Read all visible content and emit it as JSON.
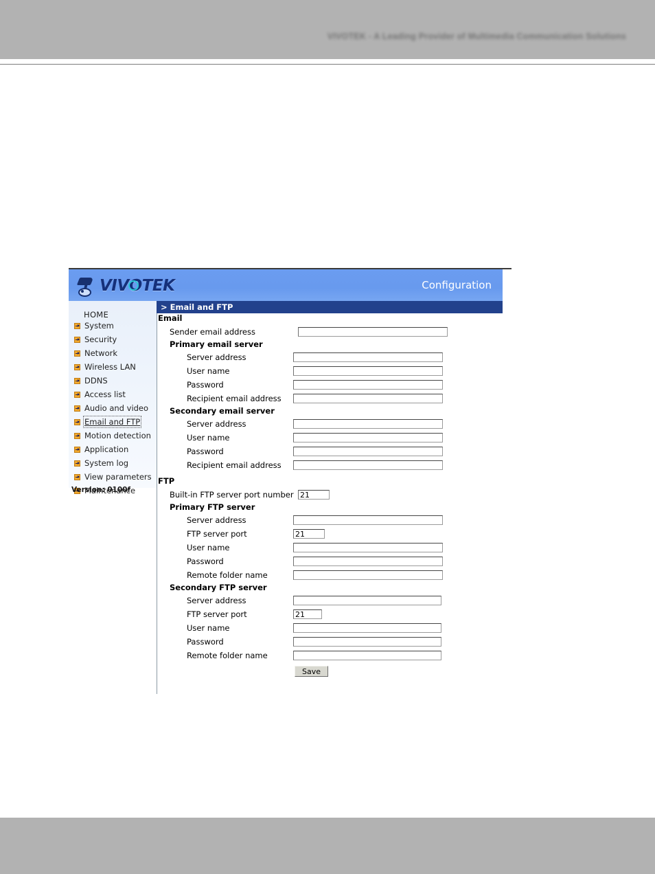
{
  "document": {
    "banner_tagline": "VIVOTEK - A Leading Provider of Multimedia Communication Solutions"
  },
  "header": {
    "logo_text_1": "VIV",
    "logo_text_o": "O",
    "logo_text_2": "TEK",
    "title": "Configuration",
    "bg_color": "#6699ee"
  },
  "titlebar": {
    "text": "> Email and FTP",
    "bg_color": "#22418c"
  },
  "sidebar": {
    "home_label": "HOME",
    "version": "Version: 0100f",
    "items": [
      {
        "label": "System",
        "active": false
      },
      {
        "label": "Security",
        "active": false
      },
      {
        "label": "Network",
        "active": false
      },
      {
        "label": "Wireless LAN",
        "active": false
      },
      {
        "label": "DDNS",
        "active": false
      },
      {
        "label": "Access list",
        "active": false
      },
      {
        "label": "Audio and video",
        "active": false
      },
      {
        "label": "Email and FTP",
        "active": true
      },
      {
        "label": "Motion detection",
        "active": false
      },
      {
        "label": "Application",
        "active": false
      },
      {
        "label": "System log",
        "active": false
      },
      {
        "label": "View parameters",
        "active": false
      },
      {
        "label": "Maintenance",
        "active": false
      }
    ]
  },
  "content": {
    "email_section": {
      "heading": "Email",
      "sender_label": "Sender email address",
      "sender_value": "",
      "primary": {
        "heading": "Primary email server",
        "server_address_label": "Server address",
        "server_address_value": "",
        "user_name_label": "User name",
        "user_name_value": "",
        "password_label": "Password",
        "password_value": "",
        "recipient_label": "Recipient email address",
        "recipient_value": ""
      },
      "secondary": {
        "heading": "Secondary email server",
        "server_address_label": "Server address",
        "server_address_value": "",
        "user_name_label": "User name",
        "user_name_value": "",
        "password_label": "Password",
        "password_value": "",
        "recipient_label": "Recipient email address",
        "recipient_value": ""
      }
    },
    "ftp_section": {
      "heading": "FTP",
      "builtin_port_label": "Built-in FTP server port number",
      "builtin_port_value": "21",
      "primary": {
        "heading": "Primary FTP server",
        "server_address_label": "Server address",
        "server_address_value": "",
        "port_label": "FTP server port",
        "port_value": "21",
        "user_name_label": "User name",
        "user_name_value": "",
        "password_label": "Password",
        "password_value": "",
        "remote_folder_label": "Remote folder name",
        "remote_folder_value": ""
      },
      "secondary": {
        "heading": "Secondary FTP server",
        "server_address_label": "Server address",
        "server_address_value": "",
        "port_label": "FTP server port",
        "port_value": "21",
        "user_name_label": "User name",
        "user_name_value": "",
        "password_label": "Password",
        "password_value": "",
        "remote_folder_label": "Remote folder name",
        "remote_folder_value": ""
      }
    },
    "save_label": "Save"
  }
}
